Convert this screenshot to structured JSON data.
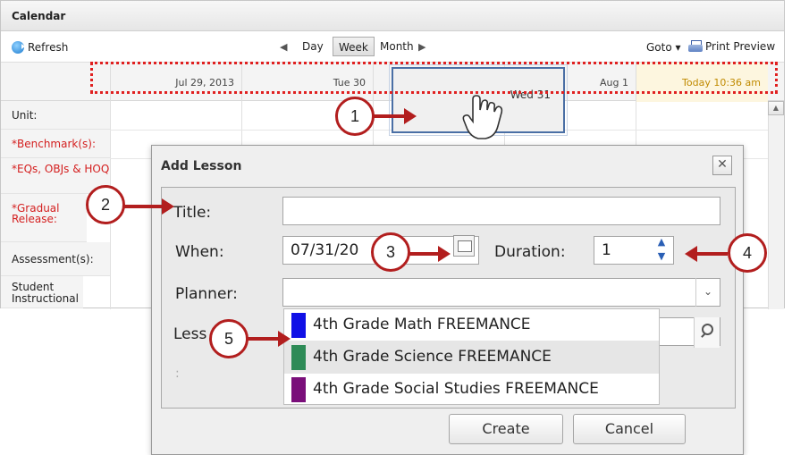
{
  "calendar": {
    "title": "Calendar",
    "refresh_label": "Refresh",
    "nav": {
      "prev_icon": "triangle-left",
      "next_icon": "triangle-right",
      "views": [
        "Day",
        "Week",
        "Month"
      ],
      "active_view": "Week"
    },
    "goto_label": "Goto ▾",
    "print_label": "Print Preview",
    "days": [
      "Jul 29, 2013",
      "Tue 30",
      "Wed 31",
      "Aug 1",
      "Today 10:36 am"
    ],
    "row_labels": [
      "Unit:",
      "*Benchmark(s):",
      "*EQs, OBJs & HOQ",
      "*Gradual Release:",
      "Assessment(s):",
      "Student Instructional"
    ]
  },
  "dialog": {
    "title": "Add Lesson",
    "close_icon": "close-x",
    "title_label": "Title:",
    "title_value": "",
    "when_label": "When:",
    "when_value": "07/31/20",
    "duration_label": "Duration:",
    "duration_value": "1",
    "planner_label": "Planner:",
    "planner_value": "",
    "lesson_label": "Less",
    "colon": ":",
    "planner_options": [
      {
        "label": "4th Grade Math FREEMANCE",
        "color": "#1010e6"
      },
      {
        "label": "4th Grade Science FREEMANCE",
        "color": "#2e8b57"
      },
      {
        "label": "4th Grade Social Studies FREEMANCE",
        "color": "#7a0f7a"
      }
    ],
    "create_label": "Create",
    "cancel_label": "Cancel"
  },
  "callouts": [
    "1",
    "2",
    "3",
    "4",
    "5"
  ],
  "accent": "#b21e1e"
}
